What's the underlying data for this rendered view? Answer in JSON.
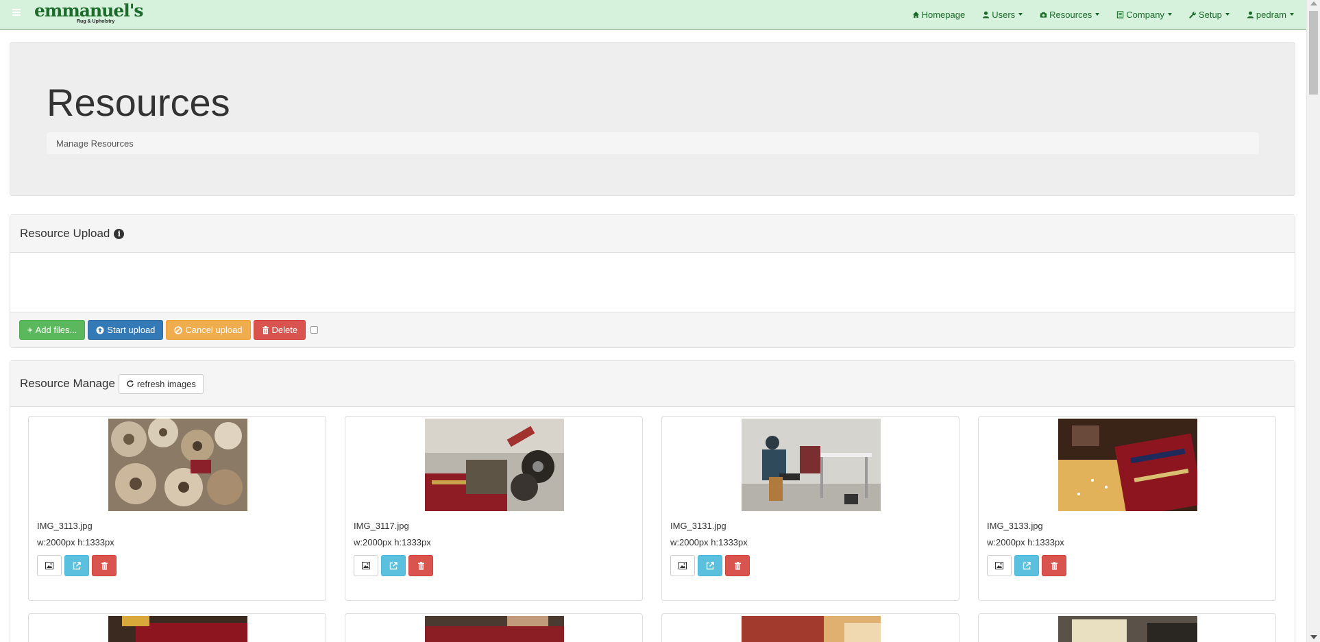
{
  "brand": {
    "name": "emmanuel's",
    "tagline": "Rug & Upholstry"
  },
  "nav": {
    "items": [
      {
        "label": "Homepage",
        "icon": "home-icon",
        "dropdown": false
      },
      {
        "label": "Users",
        "icon": "user-icon",
        "dropdown": true
      },
      {
        "label": "Resources",
        "icon": "camera-icon",
        "dropdown": true
      },
      {
        "label": "Company",
        "icon": "list-icon",
        "dropdown": true
      },
      {
        "label": "Setup",
        "icon": "wrench-icon",
        "dropdown": true
      },
      {
        "label": "pedram",
        "icon": "user-icon",
        "dropdown": true
      }
    ]
  },
  "header": {
    "title": "Resources",
    "breadcrumb": "Manage Resources"
  },
  "upload": {
    "title": "Resource Upload",
    "buttons": {
      "add": "Add files...",
      "start": "Start upload",
      "cancel": "Cancel upload",
      "delete": "Delete"
    }
  },
  "manage": {
    "title": "Resource Manage",
    "refresh_label": "refresh images",
    "images": [
      {
        "name": "IMG_3113.jpg",
        "dims": "w:2000px h:1333px"
      },
      {
        "name": "IMG_3117.jpg",
        "dims": "w:2000px h:1333px"
      },
      {
        "name": "IMG_3131.jpg",
        "dims": "w:2000px h:1333px"
      },
      {
        "name": "IMG_3133.jpg",
        "dims": "w:2000px h:1333px"
      }
    ]
  },
  "colors": {
    "navbar": "#d6f1dc",
    "brand": "#1c6b2a",
    "success": "#5cb85c",
    "primary": "#337ab7",
    "warning": "#f0ad4e",
    "danger": "#d9534f",
    "info": "#5bc0de"
  }
}
